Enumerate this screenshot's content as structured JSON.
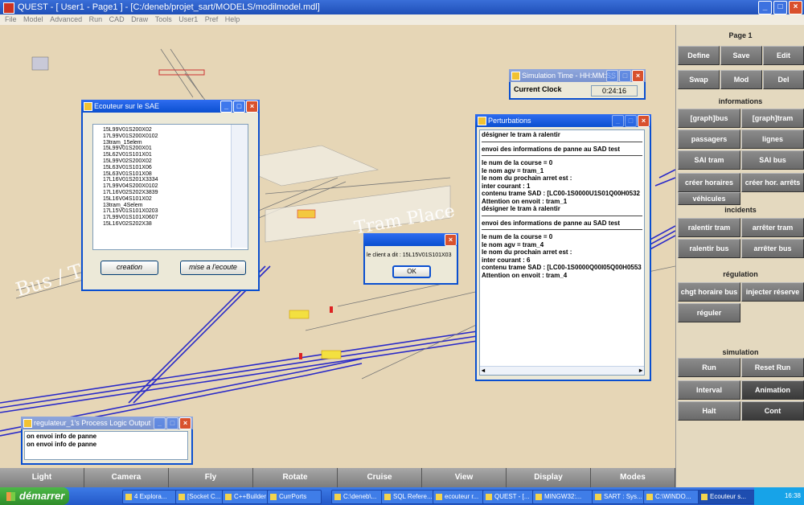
{
  "window": {
    "title": "QUEST - [ User1 - Page1 ] - [C:/deneb/projet_sart/MODELS/modilmodel.mdl]"
  },
  "menu": [
    "File",
    "Model",
    "Advanced",
    "Run",
    "CAD",
    "Draw",
    "Tools",
    "User1",
    "Pref",
    "Help"
  ],
  "scene_text": {
    "bus_tram": "Bus / Tra",
    "tram_label": "Tram Place"
  },
  "ecouteur": {
    "title": "Ecouteur sur le SAE",
    "list": [
      "15L99V01S200X02",
      "17L99V01S200X0102",
      "13tram_15elem",
      "15L99V01S200X01",
      "15L62V01S101X01",
      "15L99V02S200X02",
      "15L63V01S101X06",
      "15L63V01S101X08",
      "17L16V01S201X3334",
      "17L99V04S200X0102",
      "17L16V02S202X3839",
      "15L16V04S101X02",
      "13tram_4Selem",
      "17L15V01S101X0203",
      "17L99V01S101X0607",
      "15L16V02S202X38"
    ],
    "btn_creation": "creation",
    "btn_ecoute": "mise a l'ecoute"
  },
  "simtime": {
    "title": "Simulation Time - HH:MM:SS",
    "label": "Current Clock",
    "value": "0:24:16"
  },
  "perturb": {
    "title": "Perturbations",
    "lines": [
      {
        "t": "désigner le tram à ralentir"
      },
      {
        "t": "",
        "sep": true
      },
      {
        "t": "envoi des informations de panne au SAD test"
      },
      {
        "t": "",
        "sep": true
      },
      {
        "t": "le num de la course = 0"
      },
      {
        "t": "le nom agv = tram_1"
      },
      {
        "t": "le nom du prochain arret est :"
      },
      {
        "t": "inter courant : 1"
      },
      {
        "t": "contenu trame SAD : [LC00-1S0000U1S01Q00H0532"
      },
      {
        "t": "Attention on envoit : tram_1"
      },
      {
        "t": "désigner le tram à ralentir"
      },
      {
        "t": "",
        "sep": true
      },
      {
        "t": "envoi des informations de panne au SAD test"
      },
      {
        "t": "",
        "sep": true
      },
      {
        "t": "le num de la course = 0"
      },
      {
        "t": "le nom agv = tram_4"
      },
      {
        "t": "le nom du prochain arret est :"
      },
      {
        "t": "inter courant : 6"
      },
      {
        "t": "contenu trame SAD : [LC00-1S0000Q00I05Q00H0553"
      },
      {
        "t": "Attention on envoit : tram_4"
      }
    ]
  },
  "msgbox": {
    "text": "le client a dit :  15L15V01S101X03",
    "ok": "OK"
  },
  "regulateur": {
    "title": "regulateur_1's Process Logic Output",
    "lines": [
      "on envoi info de panne",
      "on envoi info de panne"
    ]
  },
  "panel": {
    "page": "Page 1",
    "row1": [
      "Define",
      "Save",
      "Edit"
    ],
    "row2": [
      "Swap",
      "Mod",
      "Del"
    ],
    "informations": "informations",
    "info_buttons": [
      "[graph]bus",
      "[graph]tram",
      "passagers",
      "lignes",
      "SAI tram",
      "SAI bus",
      "créer horaires",
      "créer hor. arrêts",
      "véhicules"
    ],
    "incidents": "incidents",
    "incident_buttons": [
      "ralentir tram",
      "arrêter tram",
      "ralentir bus",
      "arrêter bus"
    ],
    "regulation": "régulation",
    "regulation_buttons": [
      "chgt horaire bus",
      "injecter réserve",
      "réguler"
    ],
    "simulation": "simulation",
    "simulation_buttons": [
      "Run",
      "Reset Run",
      "Interval",
      "Animation",
      "Halt",
      "Cont"
    ]
  },
  "bottombar": [
    "Light",
    "Camera",
    "Fly",
    "Rotate",
    "Cruise",
    "View",
    "Display",
    "Modes"
  ],
  "taskbar": {
    "start": "démarrer",
    "tasks": [
      "4 Explora...",
      "[Socket C...",
      "C++Builder 6",
      "CurrPorts",
      "C:\\deneb\\...",
      "SQL Refere...",
      "ecouteur r...",
      "QUEST - [...",
      "MINGW32:...",
      "SART : Sys...",
      "C:\\WINDO...",
      "Ecouteur s..."
    ],
    "clock": "16:38"
  },
  "colors": {
    "track": "#2a2ac8",
    "scene": "#e6d6b6",
    "xp_blue": "#0a4fd0"
  }
}
